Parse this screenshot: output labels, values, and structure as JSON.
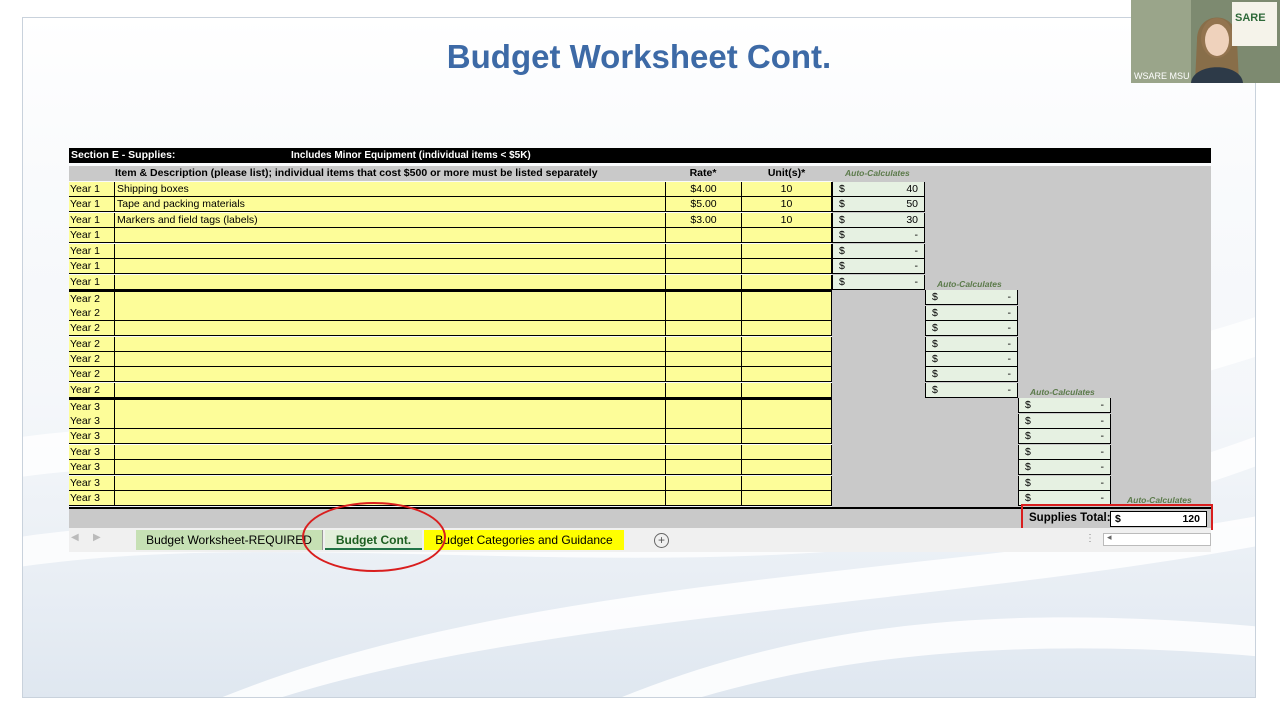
{
  "slide": {
    "title": "Budget Worksheet Cont."
  },
  "sheet": {
    "section_title": "Section E - Supplies:",
    "section_note": "Includes Minor Equipment (individual items < $5K)",
    "col_item": "Item & Description (please list); individual items that cost $500 or more must be listed separately",
    "col_rate": "Rate*",
    "col_units": "Unit(s)*",
    "auto_calc": "Auto-Calculates",
    "rows": [
      {
        "year": "Year 1",
        "item": "Shipping boxes",
        "rate": "$4.00",
        "units": "10",
        "dollar": "$",
        "amount": "40",
        "block": 1
      },
      {
        "year": "Year 1",
        "item": "Tape and packing materials",
        "rate": "$5.00",
        "units": "10",
        "dollar": "$",
        "amount": "50",
        "block": 1
      },
      {
        "year": "Year 1",
        "item": "Markers and field tags (labels)",
        "rate": "$3.00",
        "units": "10",
        "dollar": "$",
        "amount": "30",
        "block": 1
      },
      {
        "year": "Year 1",
        "item": "",
        "rate": "",
        "units": "",
        "dollar": "$",
        "amount": "-",
        "block": 1
      },
      {
        "year": "Year 1",
        "item": "",
        "rate": "",
        "units": "",
        "dollar": "$",
        "amount": "-",
        "block": 1
      },
      {
        "year": "Year 1",
        "item": "",
        "rate": "",
        "units": "",
        "dollar": "$",
        "amount": "-",
        "block": 1
      },
      {
        "year": "Year 1",
        "item": "",
        "rate": "",
        "units": "",
        "dollar": "$",
        "amount": "-",
        "block": 1
      },
      {
        "year": "Year 2",
        "item": "",
        "rate": "",
        "units": "",
        "dollar": "$",
        "amount": "-",
        "block": 2
      },
      {
        "year": "Year 2",
        "item": "",
        "rate": "",
        "units": "",
        "dollar": "$",
        "amount": "-",
        "block": 2
      },
      {
        "year": "Year 2",
        "item": "",
        "rate": "",
        "units": "",
        "dollar": "$",
        "amount": "-",
        "block": 2
      },
      {
        "year": "Year 2",
        "item": "",
        "rate": "",
        "units": "",
        "dollar": "$",
        "amount": "-",
        "block": 2
      },
      {
        "year": "Year 2",
        "item": "",
        "rate": "",
        "units": "",
        "dollar": "$",
        "amount": "-",
        "block": 2
      },
      {
        "year": "Year 2",
        "item": "",
        "rate": "",
        "units": "",
        "dollar": "$",
        "amount": "-",
        "block": 2
      },
      {
        "year": "Year 2",
        "item": "",
        "rate": "",
        "units": "",
        "dollar": "$",
        "amount": "-",
        "block": 2
      },
      {
        "year": "Year 3",
        "item": "",
        "rate": "",
        "units": "",
        "dollar": "$",
        "amount": "-",
        "block": 3
      },
      {
        "year": "Year 3",
        "item": "",
        "rate": "",
        "units": "",
        "dollar": "$",
        "amount": "-",
        "block": 3
      },
      {
        "year": "Year 3",
        "item": "",
        "rate": "",
        "units": "",
        "dollar": "$",
        "amount": "-",
        "block": 3
      },
      {
        "year": "Year 3",
        "item": "",
        "rate": "",
        "units": "",
        "dollar": "$",
        "amount": "-",
        "block": 3
      },
      {
        "year": "Year 3",
        "item": "",
        "rate": "",
        "units": "",
        "dollar": "$",
        "amount": "-",
        "block": 3
      },
      {
        "year": "Year 3",
        "item": "",
        "rate": "",
        "units": "",
        "dollar": "$",
        "amount": "-",
        "block": 3
      },
      {
        "year": "Year 3",
        "item": "",
        "rate": "",
        "units": "",
        "dollar": "$",
        "amount": "-",
        "block": 3
      }
    ],
    "total_label": "Supplies Total:",
    "total_dollar": "$",
    "total_value": "120"
  },
  "tabs": {
    "items": [
      {
        "label": "Budget Worksheet-REQUIRED",
        "active": false,
        "color": "#c6e0b4"
      },
      {
        "label": "Budget Cont.",
        "active": true,
        "color": "#c6e0b4"
      },
      {
        "label": "Budget Categories and Guidance",
        "active": false,
        "color": "#ffff00"
      }
    ],
    "add_symbol": "+"
  },
  "webcam": {
    "label": "WSARE MSU",
    "logo_text": "SARE"
  },
  "colors": {
    "title": "#3d6aa6",
    "highlight_red": "#d91e1e",
    "input_yellow": "#fdfd99"
  }
}
